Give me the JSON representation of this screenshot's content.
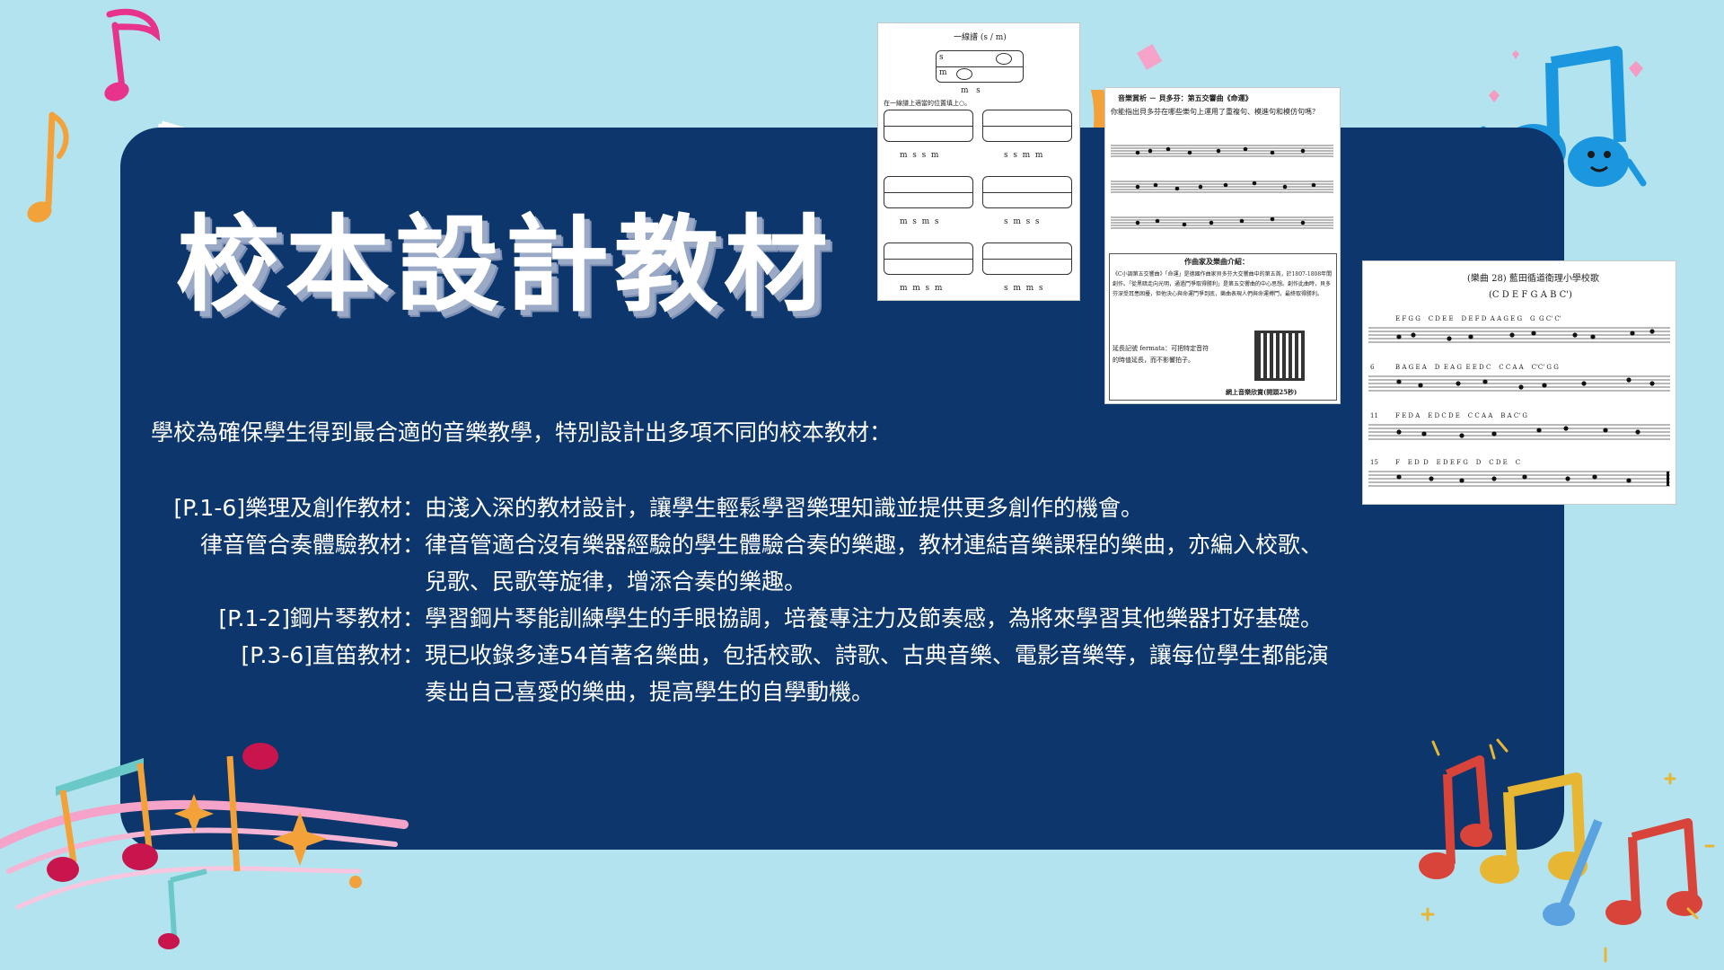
{
  "title": "校本設計教材",
  "intro": "學校為確保學生得到最合適的音樂教學，特別設計出多項不同的校本教材：",
  "items": [
    {
      "label": "[P.1-6]樂理及創作教材：",
      "lines": [
        "由淺入深的教材設計，讓學生輕鬆學習樂理知識並提供更多創作的機會。"
      ]
    },
    {
      "label": "律音管合奏體驗教材：",
      "lines": [
        "律音管適合沒有樂器經驗的學生體驗合奏的樂趣，教材連結音樂課程的樂曲，亦編入校歌、",
        "兒歌、民歌等旋律，增添合奏的樂趣。"
      ]
    },
    {
      "label": "[P.1-2]鋼片琴教材：",
      "lines": [
        "學習鋼片琴能訓練學生的手眼協調，培養專注力及節奏感，為將來學習其他樂器打好基礎。"
      ]
    },
    {
      "label": "[P.3-6]直笛教材：",
      "lines": [
        "現已收錄多達54首著名樂曲，包括校歌、詩歌、古典音樂、電影音樂等，讓每位學生都能演",
        "奏出自己喜愛的樂曲，提高學生的自學動機。"
      ]
    }
  ],
  "worksheet1": {
    "heading": "一線譜 (s / m)",
    "line_s": "s",
    "line_m": "m",
    "top_syllables": "m   s",
    "instruction": "在一線譜上適當的位置填上○。",
    "boxes": [
      {
        "syllables": "m  s  s  m"
      },
      {
        "syllables": "s  s  m  m"
      },
      {
        "syllables": "m  s  m  s"
      },
      {
        "syllables": "s  m  s  s"
      },
      {
        "syllables": "m  m  s  m"
      },
      {
        "syllables": "s  m  m  s"
      }
    ]
  },
  "worksheet2": {
    "heading": "音樂賞析 － 貝多芬：第五交響曲《命運》",
    "question": "你能指出貝多芬在哪些樂句上運用了重複句、模進句和模仿句嗎？",
    "composer_heading": "作曲家及樂曲介紹：",
    "composer_text": "《C小調第五交響曲》「命運」是德國作曲家貝多芬大交響曲中的第五首，於1807-1808年間創作。「從黑暗走向光明，通過鬥爭取得勝利」是第五交響曲的中心思想。創作此曲時，貝多芬深受耳患困擾，但他決心與命運鬥爭到底，樂曲表現人們與命運搏鬥，最終取得勝利。",
    "fermata_note": "延長記號 fermata：可把特定音符的時值延長，而不影響拍子。",
    "online_label": "網上音樂欣賞(開頭25秒)"
  },
  "worksheet3": {
    "heading": "(樂曲 28) 藍田循道衛理小學校歌",
    "scale": "(C D E F G A B C')",
    "rows": [
      {
        "num": "",
        "notes": "E F G G    C D E E    D E F D  A A G E G    G  G C' C'"
      },
      {
        "num": "6",
        "notes": "B A G E A    D  E A G  E E D C    C C A A    C'C' G G"
      },
      {
        "num": "11",
        "notes": "F E D A    E D C D E    C C A A    B A C' G"
      },
      {
        "num": "15",
        "notes": "F    E D  D    E D E F G    D    C D E    C"
      }
    ]
  },
  "icons": {
    "note1": "music-note-icon",
    "note2": "eighth-note-icon",
    "characters": "music-note-characters-icon"
  }
}
